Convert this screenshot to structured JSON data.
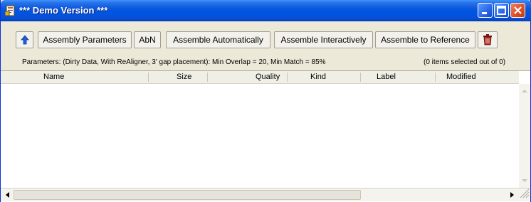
{
  "window": {
    "title": "*** Demo Version ***",
    "colors": {
      "titlebar": "#0054e3",
      "close_button": "#e04b22",
      "face": "#ece9d8"
    }
  },
  "icons": {
    "app": "app-document-icon",
    "up": "up-arrow-icon",
    "trash": "trash-icon",
    "minimize": "minimize-icon",
    "maximize": "maximize-icon",
    "close": "close-icon"
  },
  "toolbar": {
    "assembly_parameters": "Assembly Parameters",
    "abn": "AbN",
    "assemble_automatically": "Assemble Automatically",
    "assemble_interactively": "Assemble Interactively",
    "assemble_to_reference": "Assemble to Reference"
  },
  "params": {
    "text": "Parameters: (Dirty Data, With ReAligner, 3' gap placement): Min Overlap = 20, Min Match = 85%",
    "selection": "(0 items selected out of 0)"
  },
  "table": {
    "columns": [
      "Name",
      "Size",
      "Quality",
      "Kind",
      "Label",
      "Modified"
    ],
    "rows": []
  }
}
